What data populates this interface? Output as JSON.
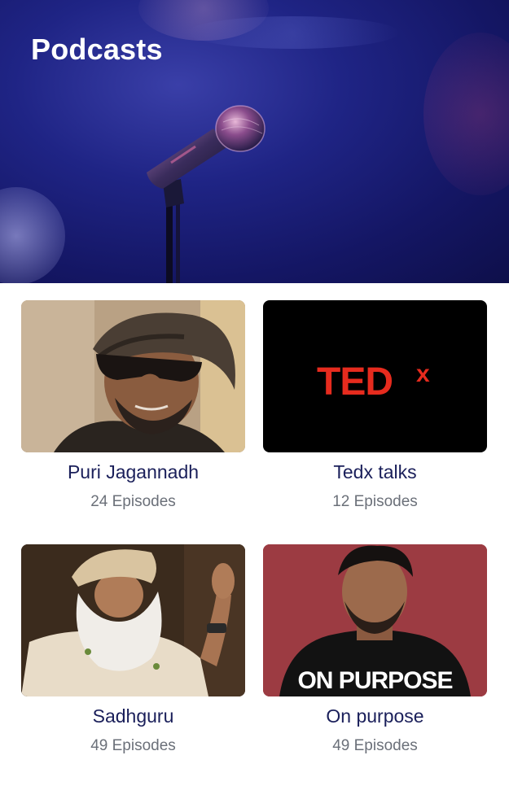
{
  "header": {
    "title": "Podcasts"
  },
  "podcasts": [
    {
      "title": "Puri Jagannadh",
      "episodes": "24 Episodes",
      "thumbnail": "portrait-headwrap-sunglasses"
    },
    {
      "title": "Tedx talks",
      "episodes": "12 Episodes",
      "thumbnail": "tedx-logo",
      "logo_text": "TEDx",
      "logo_color": "#e62b1e"
    },
    {
      "title": "Sadhguru",
      "episodes": "49 Episodes",
      "thumbnail": "portrait-turban-white-beard"
    },
    {
      "title": "On purpose",
      "episodes": "49 Episodes",
      "thumbnail": "portrait-on-purpose",
      "logo_text": "ON PURPOSE"
    }
  ],
  "colors": {
    "hero_bg": "#1f2485",
    "title_text": "#1a1f5a",
    "subtitle_text": "#6b7079"
  }
}
